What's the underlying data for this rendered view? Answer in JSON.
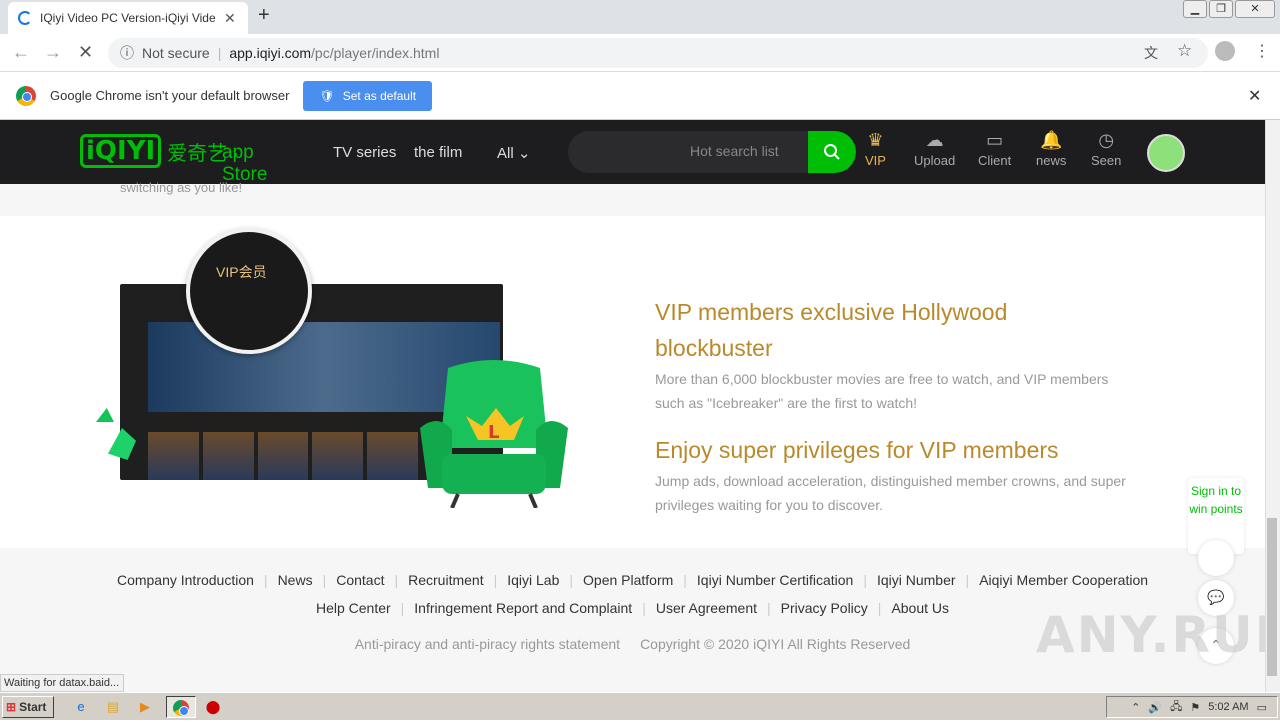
{
  "browser": {
    "tab_title": "IQiyi Video PC Version-iQiyi Video Official",
    "new_tab": "+",
    "tab_close": "✕",
    "security_label": "Not secure",
    "url_host": "app.iqiyi.com",
    "url_path": "/pc/player/index.html",
    "infobar_text": "Google Chrome isn't your default browser",
    "set_default_label": "Set as default",
    "status_text": "Waiting for datax.baid..."
  },
  "header": {
    "logo_mark": "iQIYI",
    "logo_cn": "爱奇艺 ·",
    "app_store": "app Store",
    "nav": [
      "TV series",
      "the film",
      "All"
    ],
    "search_placeholder": "Hot search list",
    "icons": [
      {
        "label": "VIP",
        "glyph": "♛",
        "icon": "crown-icon"
      },
      {
        "label": "Upload",
        "glyph": "☁",
        "icon": "upload-icon"
      },
      {
        "label": "Client",
        "glyph": "▭",
        "icon": "client-icon"
      },
      {
        "label": "news",
        "glyph": "🔔",
        "icon": "bell-icon"
      },
      {
        "label": "Seen",
        "glyph": "◷",
        "icon": "history-icon"
      }
    ],
    "accent": "#00be06"
  },
  "content": {
    "top_caption": "switching as you like!",
    "mock_vip_label": "VIP会员",
    "heading1a": "VIP members exclusive Hollywood",
    "heading1b": "blockbuster",
    "text1a": "More than 6,000 blockbuster movies are free to watch, and VIP members",
    "text1b": "such as \"Icebreaker\" are the first to watch!",
    "heading2": "Enjoy super privileges for VIP members",
    "text2a": "Jump ads, download acceleration, distinguished member crowns, and super",
    "text2b": "privileges waiting for you to discover.",
    "gold": "#b98a2b"
  },
  "footer": {
    "row1": [
      "Company Introduction",
      "News",
      "Contact",
      "Recruitment",
      "Iqiyi Lab",
      "Open Platform",
      "Iqiyi Number Certification",
      "Iqiyi Number",
      "Aiqiyi Member Cooperation"
    ],
    "row2": [
      "Help Center",
      "Infringement Report and Complaint",
      "User Agreement",
      "Privacy Policy",
      "About Us"
    ],
    "piracy": "Anti-piracy and anti-piracy rights statement",
    "copyright": "Copyright © 2020 iQIYI All Rights Reserved"
  },
  "float": {
    "signin": "Sign in to win points"
  },
  "watermark": "ANY.RUN",
  "taskbar": {
    "start": "Start",
    "time": "5:02 AM"
  }
}
